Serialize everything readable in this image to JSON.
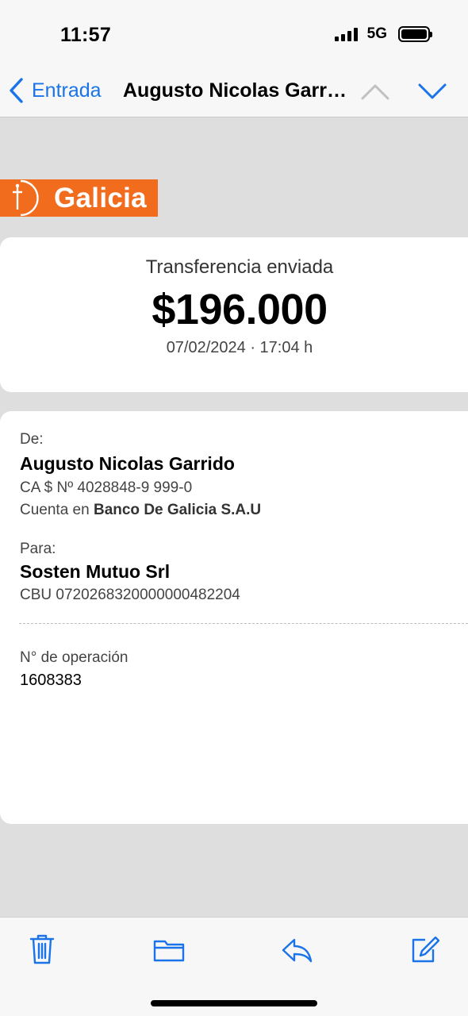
{
  "status_bar": {
    "time": "11:57",
    "network": "5G"
  },
  "nav": {
    "back_label": "Entrada",
    "title": "Augusto Nicolas Garrido"
  },
  "logo": {
    "text": "Galicia",
    "color": "#f26c1d"
  },
  "summary": {
    "label": "Transferencia enviada",
    "amount": "$196.000",
    "datetime": "07/02/2024 · 17:04 h"
  },
  "sender": {
    "label": "De:",
    "name": "Augusto Nicolas Garrido",
    "account": "CA $ Nº 4028848-9 999-0",
    "bank_prefix": "Cuenta en",
    "bank_name": "Banco De Galicia S.A.U"
  },
  "recipient": {
    "label": "Para:",
    "name": "Sosten Mutuo Srl",
    "cbu": "CBU 0720268320000000482204"
  },
  "operation": {
    "label": "N° de operación",
    "number": "1608383"
  },
  "toolbar": {
    "icons": [
      "trash-icon",
      "folder-icon",
      "reply-icon",
      "compose-icon"
    ],
    "accent": "#1a73e8"
  }
}
